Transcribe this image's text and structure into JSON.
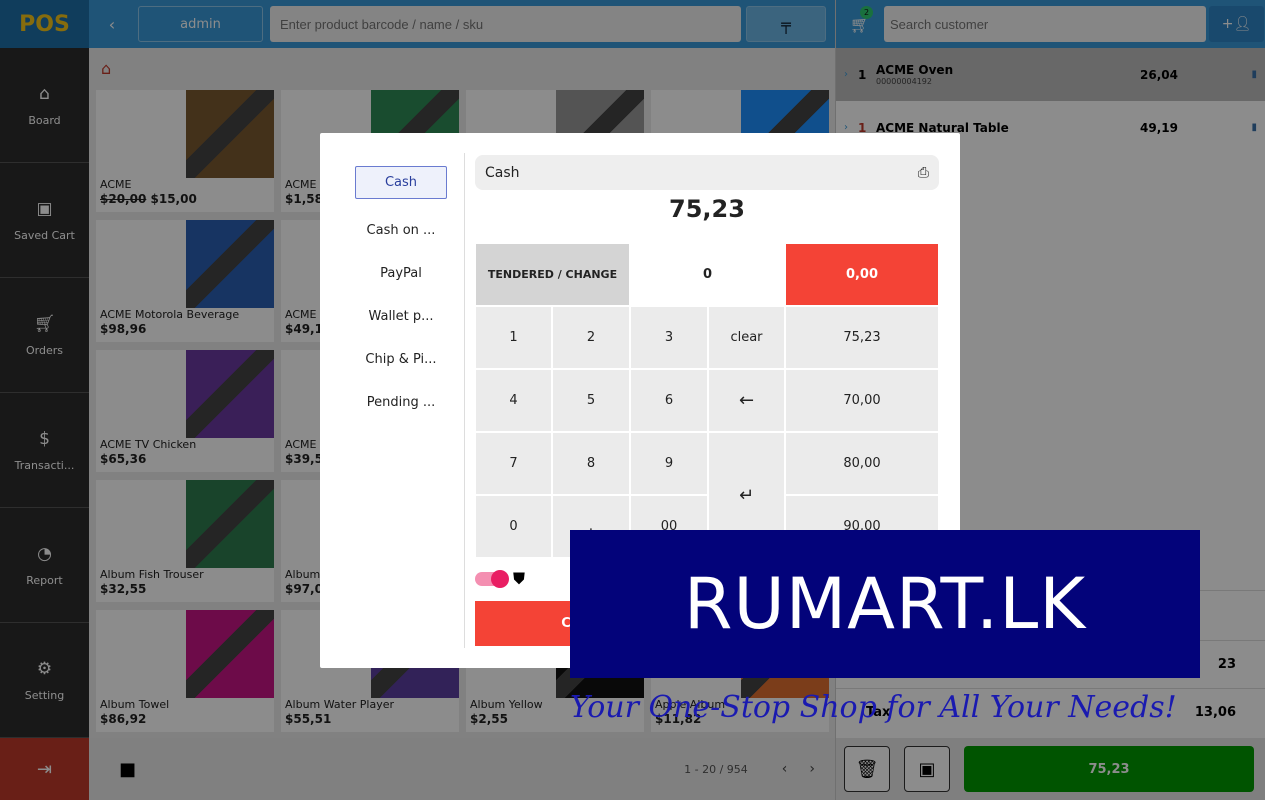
{
  "sidebar": {
    "logo": "POS",
    "items": [
      {
        "label": "Board",
        "icon": "home-icon"
      },
      {
        "label": "Saved Cart",
        "icon": "save-icon"
      },
      {
        "label": "Orders",
        "icon": "cart-icon"
      },
      {
        "label": "Transacti...",
        "icon": "dollar-icon"
      },
      {
        "label": "Report",
        "icon": "pie-chart-icon"
      },
      {
        "label": "Setting",
        "icon": "gear-icon"
      }
    ],
    "logout_icon": "logout-icon"
  },
  "topbar": {
    "user": "admin",
    "search_placeholder": "Enter product barcode / name / sku"
  },
  "products": [
    {
      "name": "ACME",
      "old_price": "$20,00",
      "price": "$15,00",
      "color": "#7a5a30"
    },
    {
      "name": "ACME",
      "price": "$1,58",
      "color": "#2e8b57"
    },
    {
      "name": "",
      "price": "",
      "color": "#9a9a9a"
    },
    {
      "name": "",
      "price": "",
      "color": "#1e90ff"
    },
    {
      "name": "ACME Motorola Beverage",
      "price": "$98,96",
      "color": "#2b5fb3"
    },
    {
      "name": "ACME",
      "price": "$49,1",
      "color": "#556b2f"
    },
    {
      "name": "",
      "price": "",
      "color": "#ccc"
    },
    {
      "name": "",
      "price": "",
      "color": "#ccc"
    },
    {
      "name": "ACME TV Chicken",
      "price": "$65,36",
      "color": "#6a3aa0"
    },
    {
      "name": "ACME",
      "price": "$39,5",
      "color": "#3f5fa3"
    },
    {
      "name": "",
      "price": "",
      "color": "#ccc"
    },
    {
      "name": "",
      "price": "",
      "color": "#ccc"
    },
    {
      "name": "Album Fish Trouser",
      "price": "$32,55",
      "color": "#2e7d4f"
    },
    {
      "name": "Album",
      "price": "$97,0",
      "color": "#8b3a3a"
    },
    {
      "name": "",
      "price": "",
      "color": "#ccc"
    },
    {
      "name": "",
      "price": "",
      "color": "#ccc"
    },
    {
      "name": "Album Towel",
      "price": "$86,92",
      "color": "#c71585"
    },
    {
      "name": "Album Water Player",
      "price": "$55,51",
      "color": "#5b3fa0"
    },
    {
      "name": "Album Yellow",
      "price": "$2,55",
      "color": "#111"
    },
    {
      "name": "Apple Album",
      "price": "$11,82",
      "color": "#e07030"
    }
  ],
  "pagination": {
    "info": "1 - 20 / 954"
  },
  "cart": {
    "count": "2",
    "customer_placeholder": "Search customer",
    "items": [
      {
        "qty": "1",
        "name": "ACME Oven",
        "sku": "00000004192",
        "total": "26,04"
      },
      {
        "qty": "1",
        "name": "ACME Natural Table",
        "sku": "",
        "total": "49,19"
      }
    ],
    "summary_rows": [
      {
        "label": "",
        "value": "23"
      },
      {
        "label": "Tax",
        "value": "13,06"
      }
    ],
    "pay_label": "75,23"
  },
  "payment_modal": {
    "methods": [
      "Cash",
      "Cash on ...",
      "PayPal",
      "Wallet p...",
      "Chip & Pi...",
      "Pending ..."
    ],
    "selected_method": "Cash",
    "amount": "75,23",
    "tendered_label": "TENDERED / CHANGE",
    "tendered": "0",
    "change": "0,00",
    "keys": [
      [
        "1",
        "2",
        "3",
        "clear",
        "75,23"
      ],
      [
        "4",
        "5",
        "6",
        "←",
        "70,00"
      ],
      [
        "7",
        "8",
        "9",
        "↵",
        "80,00"
      ],
      [
        "0",
        ".",
        "00",
        "",
        "90,00"
      ]
    ],
    "cancel_label": "Can"
  },
  "watermark": {
    "brand": "RUMART.LK",
    "tagline": "Your One-Stop Shop for All Your Needs!"
  },
  "colors": {
    "topbar": "#3a9ad9",
    "sidebar": "#2d2d2d",
    "danger": "#f44336",
    "pay": "#009a00",
    "brand_bg": "#03037a"
  }
}
